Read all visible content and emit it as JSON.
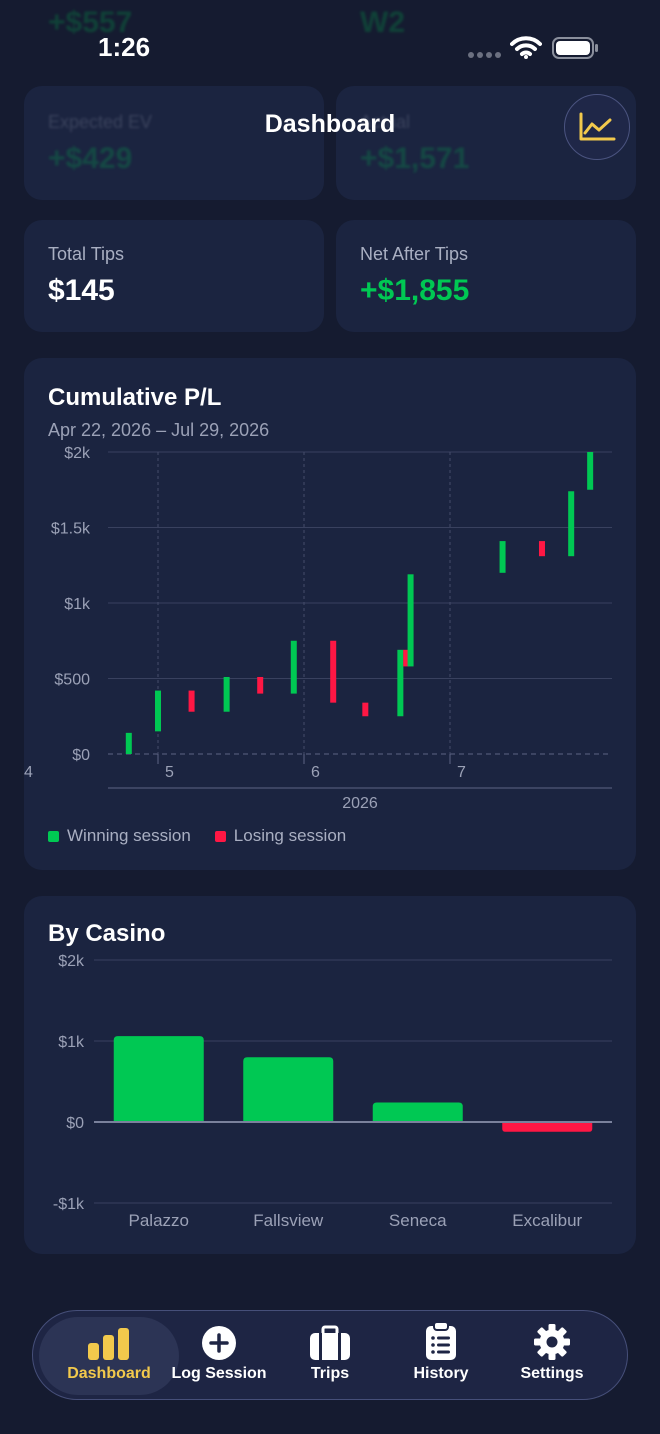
{
  "status_bar": {
    "time": "1:26"
  },
  "header": {
    "title": "Dashboard",
    "chart_button_icon": "line-chart-icon"
  },
  "behind_header": {
    "top_values": [
      "+$557",
      "W2"
    ],
    "cards": [
      {
        "label": "Expected EV",
        "value": "+$429"
      },
      {
        "label": "Actual",
        "value": "+$1,571"
      }
    ]
  },
  "stats": [
    {
      "label": "Total Tips",
      "value": "$145",
      "color": "#ffffff"
    },
    {
      "label": "Net After Tips",
      "value": "+$1,855",
      "color": "#00c853"
    }
  ],
  "colors": {
    "win": "#00c853",
    "loss": "#ff1744",
    "accent": "#f2c94c",
    "card": "#1b2440",
    "background": "#151b30"
  },
  "chart_data": [
    {
      "type": "bar",
      "title": "Cumulative P/L",
      "subtitle": "Apr 22, 2026 – Jul 29, 2026",
      "xlabel": "2026",
      "x_ticks": [
        "4",
        "5",
        "6",
        "7"
      ],
      "y_ticks": [
        "$0",
        "$500",
        "$1k",
        "$1.5k",
        "$2k"
      ],
      "ylim": [
        0,
        2000
      ],
      "grid": true,
      "legend": [
        {
          "label": "Winning session",
          "color": "#00c853"
        },
        {
          "label": "Losing session",
          "color": "#ff1744"
        }
      ],
      "legend_position": "bottom-left",
      "sessions": [
        {
          "x": 4.8,
          "open": 0,
          "close": 140
        },
        {
          "x": 5.0,
          "open": 150,
          "close": 420
        },
        {
          "x": 5.23,
          "open": 420,
          "close": 280
        },
        {
          "x": 5.47,
          "open": 280,
          "close": 510
        },
        {
          "x": 5.7,
          "open": 510,
          "close": 400
        },
        {
          "x": 5.93,
          "open": 400,
          "close": 750
        },
        {
          "x": 6.2,
          "open": 750,
          "close": 340
        },
        {
          "x": 6.42,
          "open": 340,
          "close": 250
        },
        {
          "x": 6.66,
          "open": 250,
          "close": 690
        },
        {
          "x": 6.7,
          "open": 690,
          "close": 580
        },
        {
          "x": 6.73,
          "open": 580,
          "close": 1190
        },
        {
          "x": 7.36,
          "open": 1200,
          "close": 1410
        },
        {
          "x": 7.63,
          "open": 1410,
          "close": 1310
        },
        {
          "x": 7.83,
          "open": 1310,
          "close": 1740
        },
        {
          "x": 7.96,
          "open": 1750,
          "close": 2000
        }
      ]
    },
    {
      "type": "bar",
      "title": "By Casino",
      "categories": [
        "Palazzo",
        "Fallsview",
        "Seneca",
        "Excalibur"
      ],
      "values": [
        1060,
        800,
        240,
        -120
      ],
      "y_ticks": [
        "-$1k",
        "$0",
        "$1k",
        "$2k"
      ],
      "ylim": [
        -1000,
        2000
      ],
      "grid": true
    }
  ],
  "tabs": [
    {
      "label": "Dashboard",
      "icon": "bar-chart-icon",
      "active": true
    },
    {
      "label": "Log Session",
      "icon": "plus-circle-icon",
      "active": false
    },
    {
      "label": "Trips",
      "icon": "briefcase-icon",
      "active": false
    },
    {
      "label": "History",
      "icon": "clipboard-list-icon",
      "active": false
    },
    {
      "label": "Settings",
      "icon": "gear-icon",
      "active": false
    }
  ]
}
